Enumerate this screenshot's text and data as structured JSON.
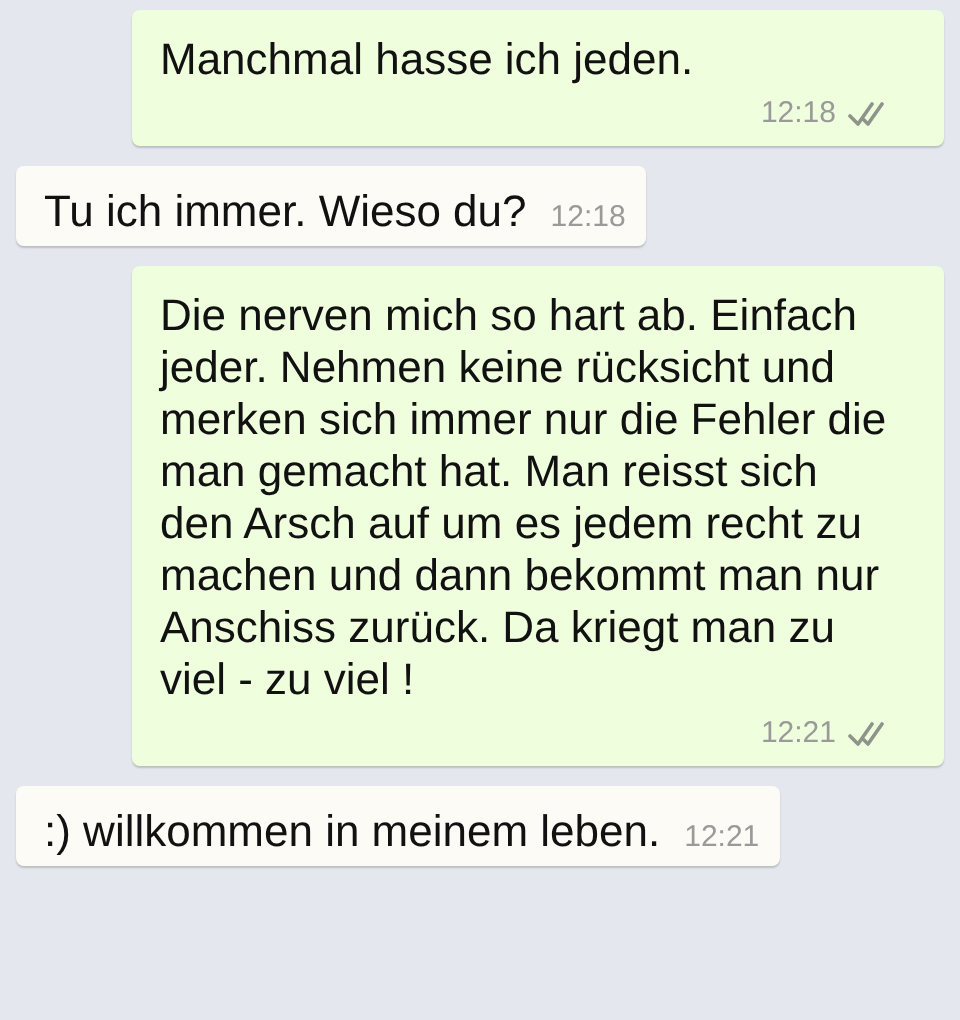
{
  "messages": [
    {
      "kind": "outgoing",
      "text": "Manchmal hasse ich jeden.",
      "time": "12:18",
      "delivered": true
    },
    {
      "kind": "incoming",
      "text": "Tu ich immer. Wieso du?",
      "time": "12:18"
    },
    {
      "kind": "outgoing",
      "text": "Die nerven mich so hart ab. Einfach jeder. Nehmen keine rücksicht und merken sich immer nur die Fehler die man gemacht hat. Man reisst sich den Arsch auf um es jedem recht zu machen und dann bekommt man nur Anschiss zurück. Da kriegt man zu viel - zu viel !",
      "time": "12:21",
      "delivered": true
    },
    {
      "kind": "incoming",
      "text": ":) willkommen in meinem leben.",
      "time": "12:21"
    }
  ]
}
